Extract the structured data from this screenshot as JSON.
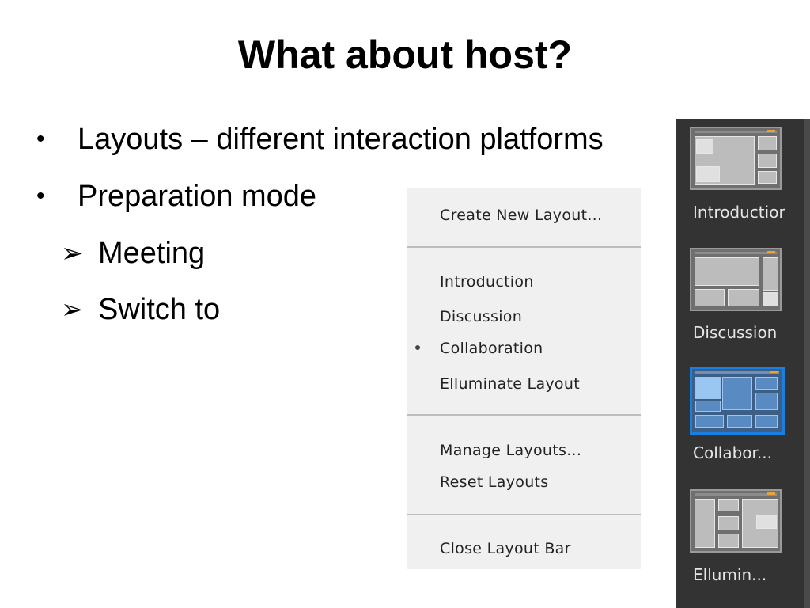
{
  "slide": {
    "title": "What about host?",
    "bullets": [
      {
        "text": "Layouts – different interaction platforms"
      },
      {
        "text": "Preparation mode"
      }
    ],
    "sub_bullets": [
      {
        "text": "Meeting"
      },
      {
        "text": "Switch to"
      }
    ],
    "bullet_glyph": "•",
    "arrow_glyph": "➢"
  },
  "menu": {
    "create": "Create New Layout...",
    "layouts": [
      "Introduction",
      "Discussion",
      "Collaboration",
      "Elluminate Layout"
    ],
    "selected": "Collaboration",
    "manage": "Manage Layouts...",
    "reset": "Reset Layouts",
    "close": "Close Layout Bar"
  },
  "layout_bar": {
    "items": [
      {
        "label": "Introductior"
      },
      {
        "label": "Discussion"
      },
      {
        "label": "Collabor..."
      },
      {
        "label": "Ellumin..."
      }
    ],
    "selected": "Collabor...",
    "accent_color": "#1a7fe0",
    "background_color": "#333333"
  }
}
